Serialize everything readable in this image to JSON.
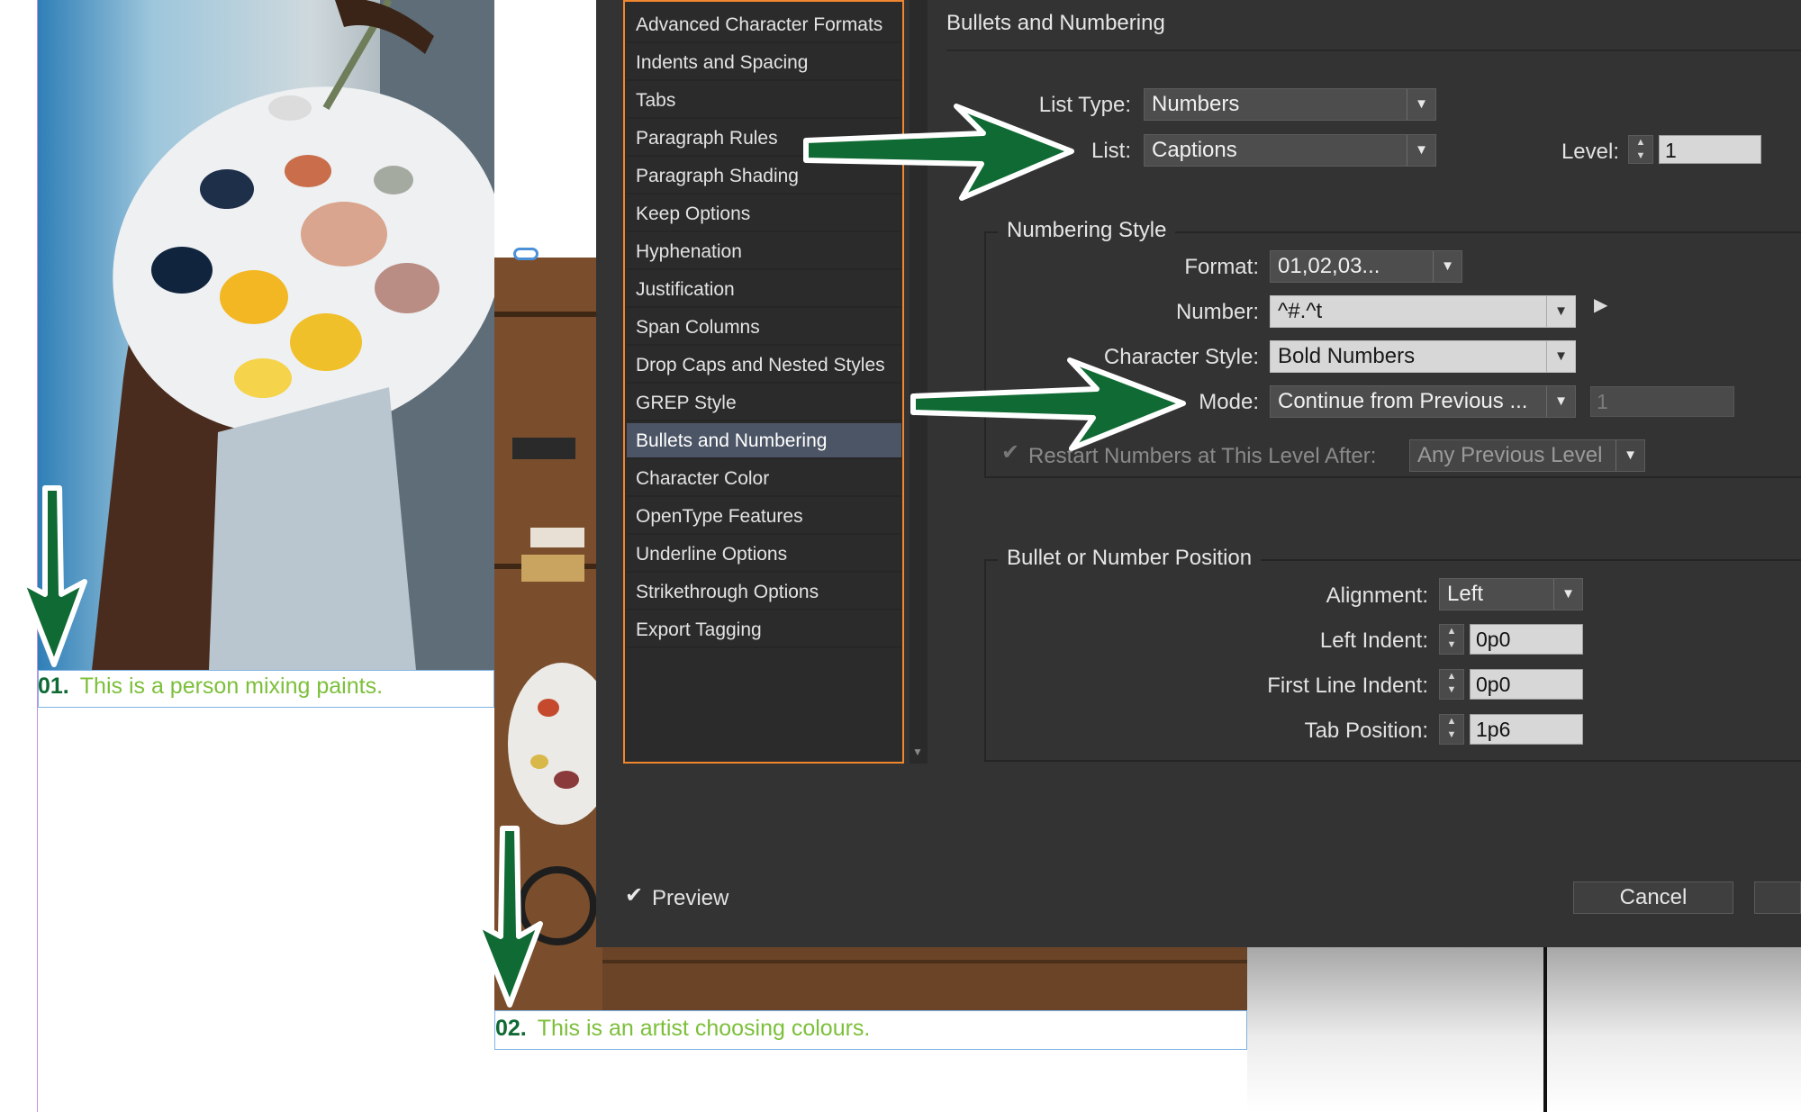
{
  "sidebar": {
    "items": [
      {
        "label": "Advanced Character Formats"
      },
      {
        "label": "Indents and Spacing"
      },
      {
        "label": "Tabs"
      },
      {
        "label": "Paragraph Rules"
      },
      {
        "label": "Paragraph Shading"
      },
      {
        "label": "Keep Options"
      },
      {
        "label": "Hyphenation"
      },
      {
        "label": "Justification"
      },
      {
        "label": "Span Columns"
      },
      {
        "label": "Drop Caps and Nested Styles"
      },
      {
        "label": "GREP Style"
      },
      {
        "label": "Bullets and Numbering"
      },
      {
        "label": "Character Color"
      },
      {
        "label": "OpenType Features"
      },
      {
        "label": "Underline Options"
      },
      {
        "label": "Strikethrough Options"
      },
      {
        "label": "Export Tagging"
      }
    ],
    "selected": "Bullets and Numbering"
  },
  "panel": {
    "title": "Bullets and Numbering",
    "list_type_label": "List Type:",
    "list_type_value": "Numbers",
    "list_label": "List:",
    "list_value": "Captions",
    "level_label": "Level:",
    "level_value": "1"
  },
  "numbering_style": {
    "title": "Numbering Style",
    "format_label": "Format:",
    "format_value": "01,02,03...",
    "number_label": "Number:",
    "number_value": "^#.^t",
    "char_style_label": "Character Style:",
    "char_style_value": "Bold Numbers",
    "mode_label": "Mode:",
    "mode_value": "Continue from Previous ...",
    "mode_start_value": "1",
    "restart_label": "Restart Numbers at This Level After:",
    "restart_checked": true,
    "restart_value": "Any Previous Level"
  },
  "position": {
    "title": "Bullet or Number Position",
    "alignment_label": "Alignment:",
    "alignment_value": "Left",
    "left_indent_label": "Left Indent:",
    "left_indent_value": "0p0",
    "first_line_label": "First Line Indent:",
    "first_line_value": "0p0",
    "tab_position_label": "Tab Position:",
    "tab_position_value": "1p6"
  },
  "footer": {
    "preview_label": "Preview",
    "preview_checked": true,
    "cancel_label": "Cancel"
  },
  "document": {
    "caption1_number": "01.",
    "caption1_text": "This is a person mixing paints.",
    "caption2_number": "02.",
    "caption2_text": "This is an artist choosing colours."
  },
  "colors": {
    "dialog_bg": "#333333",
    "sidebar_selected": "#4c5565",
    "sidebar_border": "#f0862e",
    "arrow_green": "#0f6a33",
    "caption_green": "#7cbf3a",
    "caption_number_green": "#0f6a33"
  }
}
